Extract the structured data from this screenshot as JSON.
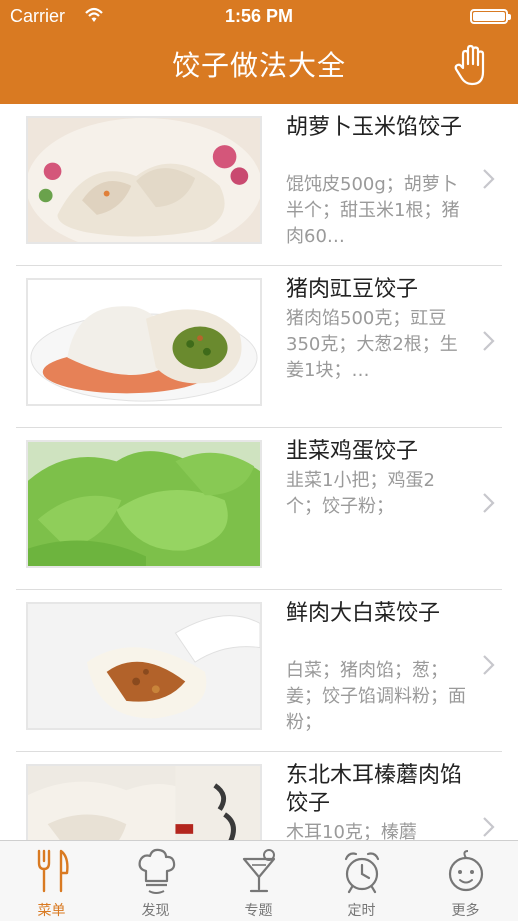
{
  "status_bar": {
    "carrier": "Carrier",
    "time": "1:56 PM"
  },
  "nav": {
    "title": "饺子做法大全",
    "right_icon": "hand-icon"
  },
  "colors": {
    "accent": "#D97A22",
    "tab_inactive": "#777777",
    "text_secondary": "#9a9a9a"
  },
  "recipes": [
    {
      "title": "胡萝卜玉米馅饺子",
      "desc": "馄饨皮500g；胡萝卜半个；甜玉米1根；猪肉60…"
    },
    {
      "title": "猪肉豇豆饺子",
      "desc": "猪肉馅500克；豇豆350克；大葱2根；生姜1块；…"
    },
    {
      "title": "韭菜鸡蛋饺子",
      "desc": "韭菜1小把；鸡蛋2个；饺子粉；"
    },
    {
      "title": "鲜肉大白菜饺子",
      "desc": "白菜；猪肉馅；葱；姜；饺子馅调料粉；面粉；"
    },
    {
      "title": "东北木耳榛蘑肉馅饺子",
      "desc": "木耳10克；榛蘑"
    }
  ],
  "tabs": [
    {
      "label": "菜单",
      "icon": "fork-knife-icon",
      "active": true
    },
    {
      "label": "发现",
      "icon": "chef-hat-icon",
      "active": false
    },
    {
      "label": "专题",
      "icon": "cocktail-icon",
      "active": false
    },
    {
      "label": "定时",
      "icon": "alarm-clock-icon",
      "active": false
    },
    {
      "label": "更多",
      "icon": "baby-face-icon",
      "active": false
    }
  ]
}
